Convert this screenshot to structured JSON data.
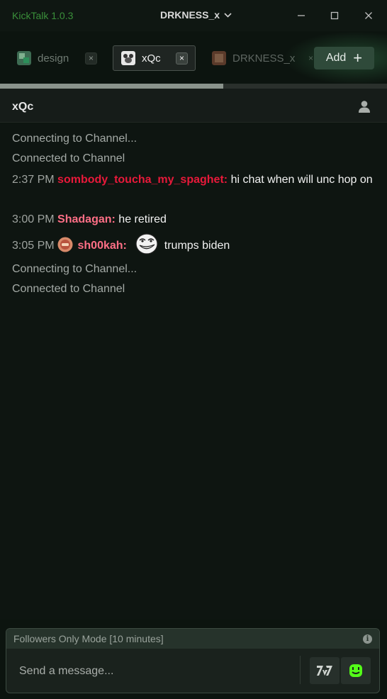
{
  "titlebar": {
    "app_title": "KickTalk 1.0.3",
    "user_name": "DRKNESS_x"
  },
  "tabs": [
    {
      "label": "design",
      "close": "×",
      "active": false
    },
    {
      "label": "xQc",
      "close": "×",
      "active": true
    },
    {
      "label": "DRKNESS_x",
      "close": "×",
      "active": false
    }
  ],
  "add_button": {
    "label": "Add",
    "icon": "+"
  },
  "progress": {
    "fraction": 0.577
  },
  "channel": {
    "name": "xQc"
  },
  "messages": [
    {
      "type": "system",
      "text": "Connecting to Channel..."
    },
    {
      "type": "system",
      "text": "Connected to Channel"
    },
    {
      "type": "chat",
      "time": "2:37 PM",
      "user": "sombody_toucha_my_spaghet:",
      "text": "hi chat when will unc hop on",
      "user_color": "#e8193a"
    },
    {
      "type": "chat",
      "time": "3:00 PM",
      "user": "Shadagan:",
      "text": "he retired",
      "user_color": "#ff6f86"
    },
    {
      "type": "chat",
      "time": "3:05 PM",
      "user": "sh00kah:",
      "text": "trumps biden",
      "user_color": "#ff6f86",
      "has_badge": true,
      "has_emote": true
    },
    {
      "type": "system",
      "text": "Connecting to Channel..."
    },
    {
      "type": "system",
      "text": "Connected to Channel"
    }
  ],
  "chat_input": {
    "mode": "Followers Only Mode [10 minutes]",
    "placeholder": "Send a message..."
  },
  "colors": {
    "accent_green": "#3a8f3a",
    "background": "#0e1511",
    "username_red": "#e8193a",
    "username_pink": "#ff6f86",
    "kick_green": "#53fc18"
  }
}
